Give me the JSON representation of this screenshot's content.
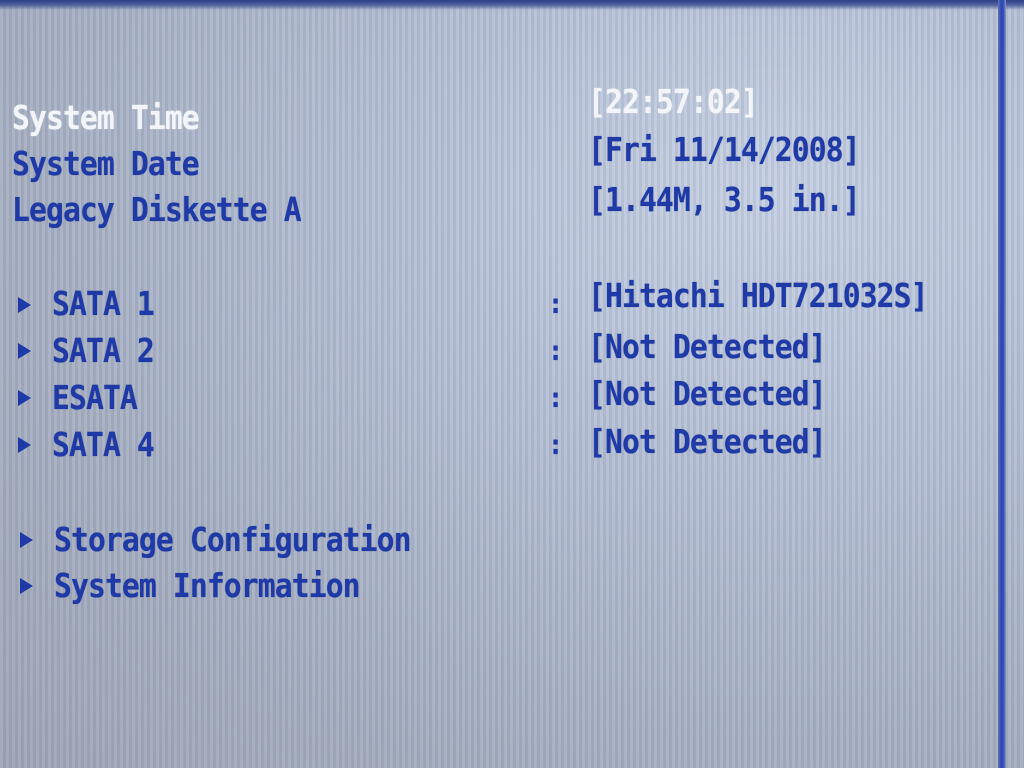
{
  "settings": [
    {
      "label": "System Time",
      "value": "[22:57:02]"
    },
    {
      "label": "System Date",
      "value": "[Fri 11/14/2008]"
    },
    {
      "label": "Legacy Diskette A",
      "value": "[1.44M, 3.5 in.]"
    }
  ],
  "drives": [
    {
      "label": "SATA 1",
      "separator": ":",
      "value": "[Hitachi HDT721032S]"
    },
    {
      "label": "SATA 2",
      "separator": ":",
      "value": "[Not Detected]"
    },
    {
      "label": "ESATA",
      "separator": ":",
      "value": "[Not Detected]"
    },
    {
      "label": "SATA 4",
      "separator": ":",
      "value": "[Not Detected]"
    }
  ],
  "submenus": [
    {
      "label": "Storage Configuration"
    },
    {
      "label": "System Information"
    }
  ],
  "colors": {
    "text": "#1f3aa6",
    "selected_text": "#f3f5fb",
    "background": "#b4bfd3",
    "border": "#2b47b5"
  },
  "icons": {
    "submenu_arrow": "triangle-right-icon"
  }
}
